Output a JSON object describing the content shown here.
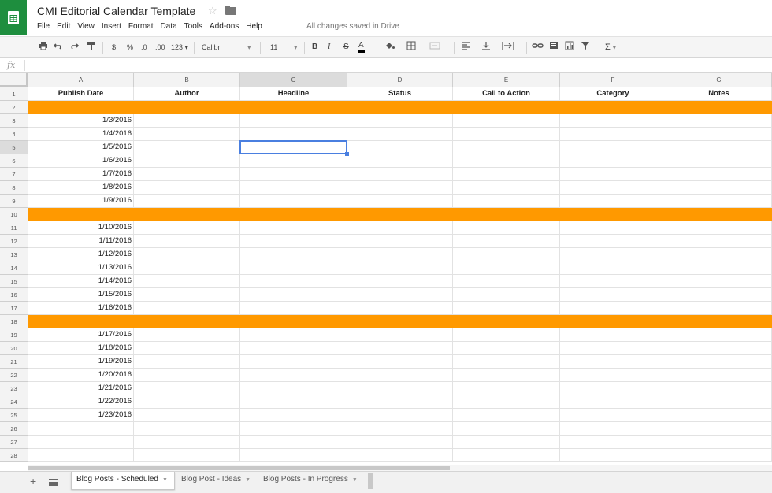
{
  "document": {
    "title": "CMI Editorial Calendar Template",
    "save_status": "All changes saved in Drive"
  },
  "menu": [
    "File",
    "Edit",
    "View",
    "Insert",
    "Format",
    "Data",
    "Tools",
    "Add-ons",
    "Help"
  ],
  "toolbar": {
    "currency": "$",
    "percent": "%",
    "decrease_decimals": ".0",
    "increase_decimals": ".00",
    "more_formats": "123",
    "font": "Calibri",
    "font_size": "11",
    "bold": "B",
    "italic": "I",
    "strikethrough": "S",
    "text_color": "A",
    "functions": "Σ"
  },
  "formula_bar": {
    "fx_label": "fx",
    "value": ""
  },
  "grid": {
    "columns": [
      "A",
      "B",
      "C",
      "D",
      "E",
      "F",
      "G"
    ],
    "selected_column": "C",
    "selected_row": 5,
    "band_color": "#ff9900",
    "headers": [
      "Publish Date",
      "Author",
      "Headline",
      "Status",
      "Call to Action",
      "Category",
      "Notes"
    ],
    "rows": [
      {
        "n": "1",
        "type": "header"
      },
      {
        "n": "2",
        "type": "band"
      },
      {
        "n": "3",
        "date": "1/3/2016"
      },
      {
        "n": "4",
        "date": "1/4/2016"
      },
      {
        "n": "5",
        "date": "1/5/2016"
      },
      {
        "n": "6",
        "date": "1/6/2016"
      },
      {
        "n": "7",
        "date": "1/7/2016"
      },
      {
        "n": "8",
        "date": "1/8/2016"
      },
      {
        "n": "9",
        "date": "1/9/2016"
      },
      {
        "n": "10",
        "type": "band"
      },
      {
        "n": "11",
        "date": "1/10/2016"
      },
      {
        "n": "12",
        "date": "1/11/2016"
      },
      {
        "n": "13",
        "date": "1/12/2016"
      },
      {
        "n": "14",
        "date": "1/13/2016"
      },
      {
        "n": "15",
        "date": "1/14/2016"
      },
      {
        "n": "16",
        "date": "1/15/2016"
      },
      {
        "n": "17",
        "date": "1/16/2016"
      },
      {
        "n": "18",
        "type": "band"
      },
      {
        "n": "19",
        "date": "1/17/2016"
      },
      {
        "n": "20",
        "date": "1/18/2016"
      },
      {
        "n": "21",
        "date": "1/19/2016"
      },
      {
        "n": "22",
        "date": "1/20/2016"
      },
      {
        "n": "23",
        "date": "1/21/2016"
      },
      {
        "n": "24",
        "date": "1/22/2016"
      },
      {
        "n": "25",
        "date": "1/23/2016"
      },
      {
        "n": "26",
        "date": ""
      },
      {
        "n": "27",
        "date": ""
      },
      {
        "n": "28",
        "date": ""
      }
    ]
  },
  "sheets": [
    {
      "label": "Blog Posts - Scheduled",
      "active": true
    },
    {
      "label": "Blog Post - Ideas",
      "active": false
    },
    {
      "label": "Blog Posts - In Progress",
      "active": false
    }
  ]
}
